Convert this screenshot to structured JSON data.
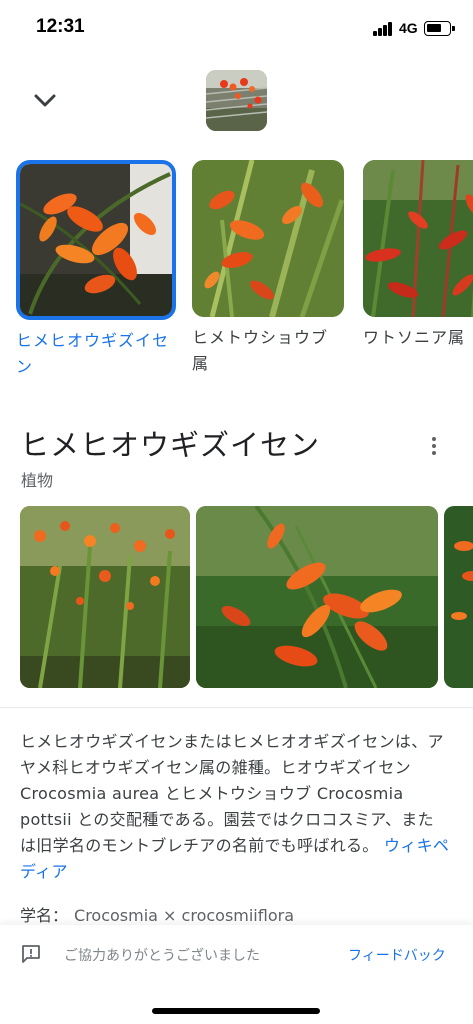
{
  "status_bar": {
    "time": "12:31",
    "network": "4G"
  },
  "carousel": {
    "items": [
      {
        "label": "ヒメヒオウギズイセン",
        "selected": true
      },
      {
        "label": "ヒメトウショウブ属",
        "selected": false
      },
      {
        "label": "ワトソニア属",
        "selected": false
      }
    ]
  },
  "entity": {
    "title": "ヒメヒオウギズイセン",
    "subtitle": "植物"
  },
  "description": {
    "text": "ヒメヒオウギズイセンまたはヒメヒオオギズイセンは、アヤメ科ヒオウギズイセン属の雑種。ヒオウギズイセン Crocosmia aurea とヒメトウショウブ Crocosmia pottsii との交配種である。園芸ではクロコスミア、または旧学名のモントブレチアの名前でも呼ばれる。",
    "source_link": "ウィキペディア"
  },
  "scientific_name": {
    "label": "学名：",
    "value": "Crocosmia × crocosmiiflora"
  },
  "feedback": {
    "message": "ご協力ありがとうございました",
    "link": "フィードバック"
  },
  "colors": {
    "accent": "#1a73e8",
    "text": "#202124",
    "secondary": "#5f6368"
  }
}
